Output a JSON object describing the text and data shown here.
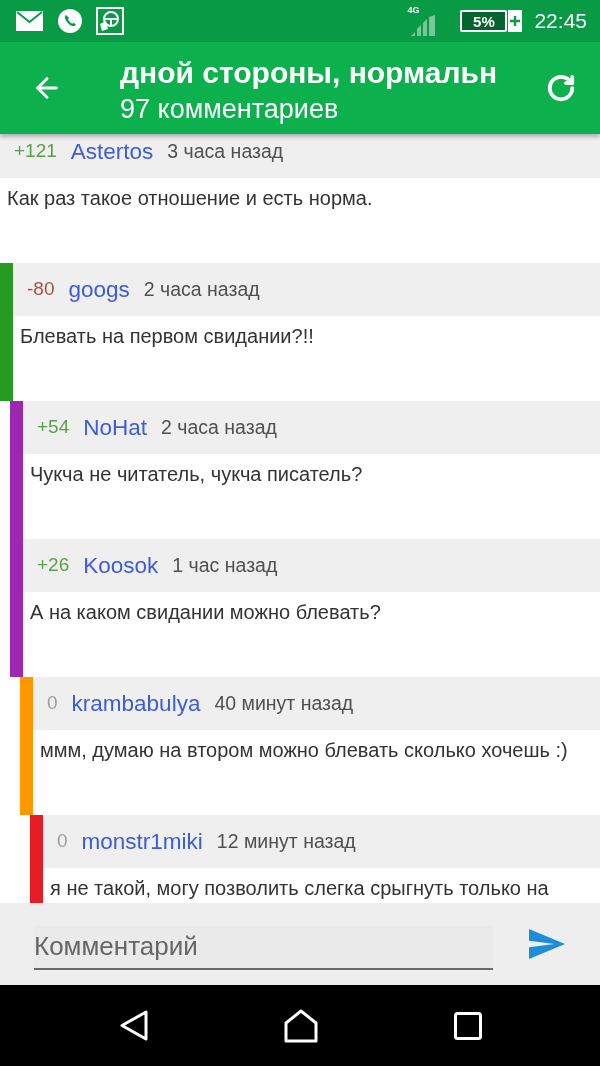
{
  "status_bar": {
    "network": "4G",
    "battery": "5%",
    "time": "22:45"
  },
  "toolbar": {
    "title": "дной стороны, нормальн",
    "subtitle": "97 комментариев"
  },
  "comments": [
    {
      "score": {
        "value": "+121",
        "color": "#5c9f4a"
      },
      "author": "Astertos",
      "time": "3 часа назад",
      "text": "Как раз такое отношение и есть норма.",
      "children": [
        {
          "score": {
            "value": "-80",
            "color": "#a4524b"
          },
          "author": "googs",
          "time": "2 часа назад",
          "text": "Блевать на первом свидании?!!",
          "color": "#259b24",
          "children": [
            {
              "score": {
                "value": "+54",
                "color": "#5c9f4a"
              },
              "author": "NoHat",
              "time": "2 часа назад",
              "text": "Чукча не читатель, чукча писатель?",
              "color": "#9c27b0"
            },
            {
              "score": {
                "value": "+26",
                "color": "#5c9f4a"
              },
              "author": "Koosok",
              "time": "1 час назад",
              "text": "А на каком свидании можно блевать?",
              "color": "#9c27b0",
              "children": [
                {
                  "score": {
                    "value": "0",
                    "color": "#a39e9c"
                  },
                  "author": "krambabulya",
                  "time": "40 минут назад",
                  "text": "ммм, думаю на втором можно блевать сколько хочешь :)",
                  "color": "#ff9800",
                  "children": [
                    {
                      "score": {
                        "value": "0",
                        "color": "#a39e9c"
                      },
                      "author": "monstr1miki",
                      "time": "12 минут назад",
                      "text": "я не такой, могу позволить слегка срыгнуть только на",
                      "color": "#e51c23"
                    }
                  ]
                }
              ]
            }
          ]
        }
      ]
    }
  ],
  "composer": {
    "placeholder": "Комментарий"
  }
}
